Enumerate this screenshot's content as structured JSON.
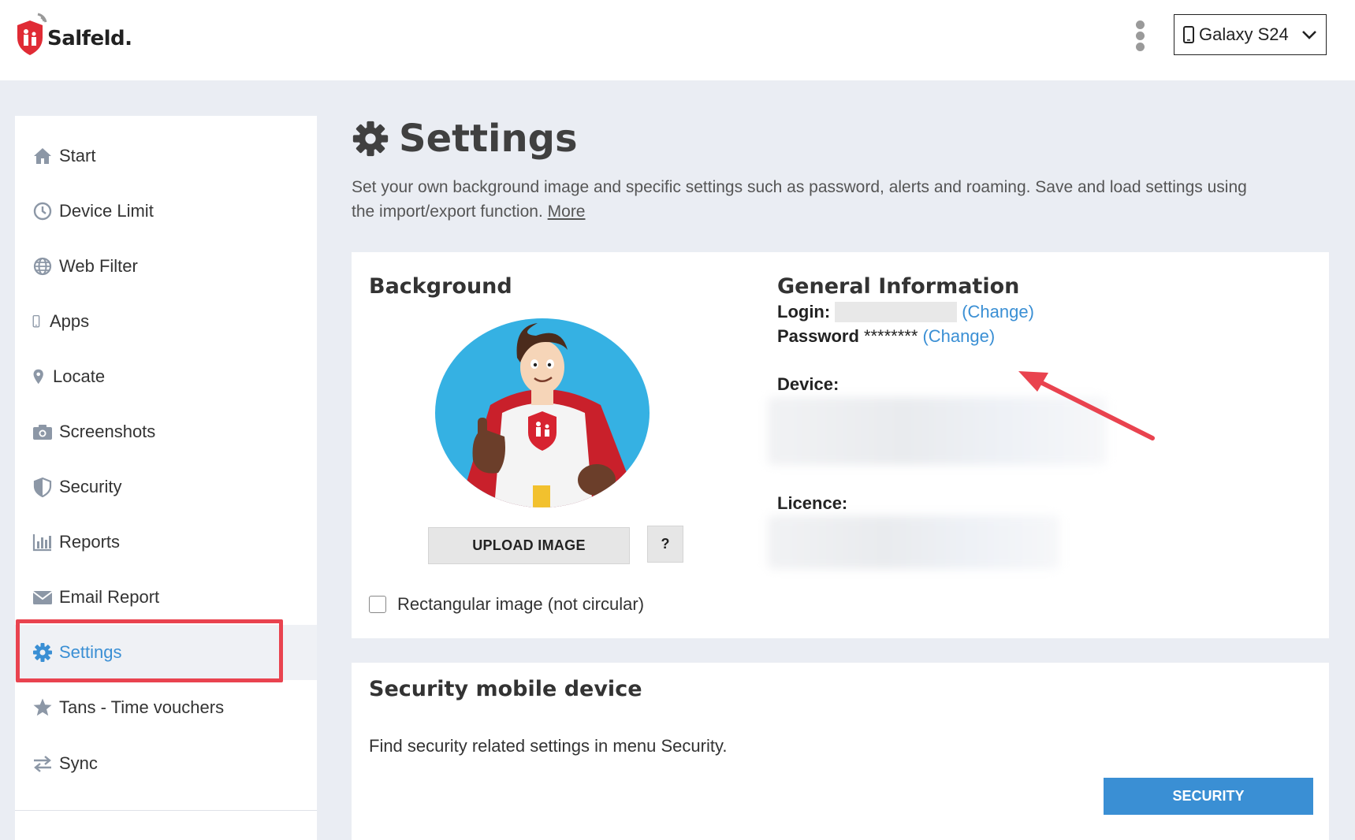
{
  "header": {
    "logo_text": "Salfeld.",
    "device_selector": {
      "value": "Galaxy S24"
    }
  },
  "sidebar": {
    "items": [
      {
        "label": "Start",
        "icon": "home-icon"
      },
      {
        "label": "Device Limit",
        "icon": "clock-icon"
      },
      {
        "label": "Web Filter",
        "icon": "globe-icon"
      },
      {
        "label": "Apps",
        "icon": "phone-icon"
      },
      {
        "label": "Locate",
        "icon": "map-pin-icon"
      },
      {
        "label": "Screenshots",
        "icon": "camera-icon"
      },
      {
        "label": "Security",
        "icon": "shield-icon"
      },
      {
        "label": "Reports",
        "icon": "bar-chart-icon"
      },
      {
        "label": "Email Report",
        "icon": "envelope-icon"
      },
      {
        "label": "Settings",
        "icon": "gear-icon",
        "active": true
      },
      {
        "label": "Tans - Time vouchers",
        "icon": "star-icon"
      },
      {
        "label": "Sync",
        "icon": "sync-arrows-icon"
      }
    ]
  },
  "page": {
    "title": "Settings",
    "intro": "Set your own background image and specific settings such as password, alerts and roaming. Save and load settings using the import/export function.",
    "more_link": "More"
  },
  "background_card": {
    "title": "Background",
    "upload_button": "UPLOAD IMAGE",
    "help_button": "?",
    "checkbox_label": "Rectangular image (not circular)",
    "checkbox_checked": false
  },
  "general_info": {
    "title": "General Information",
    "login_label": "Login:",
    "login_change": "(Change)",
    "password_label": "Password",
    "password_value": "********",
    "password_change": "(Change)",
    "device_label": "Device:",
    "licence_label": "Licence:"
  },
  "security_card": {
    "title": "Security mobile device",
    "description": "Find security related settings in menu Security.",
    "button": "SECURITY"
  },
  "colors": {
    "accent": "#3a8fd4",
    "highlight_red": "#e9434f",
    "page_bg": "#eaedf3"
  }
}
